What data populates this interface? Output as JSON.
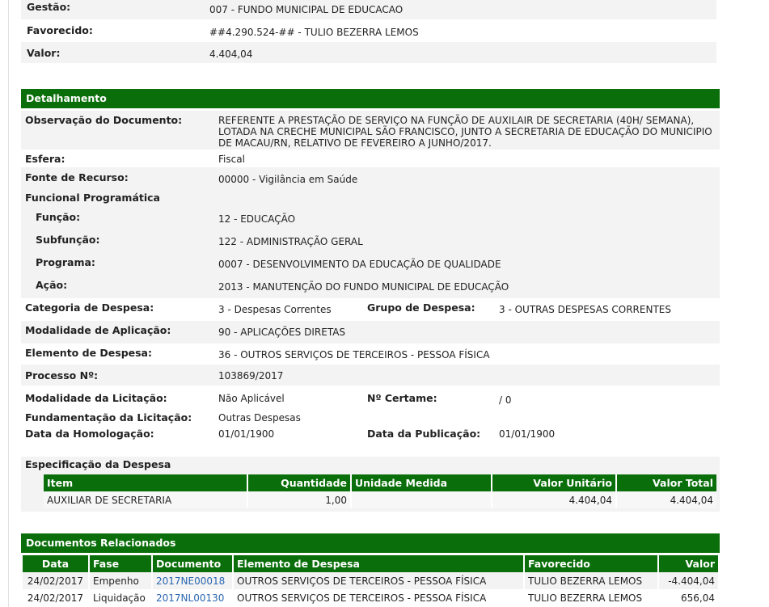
{
  "header": {
    "gestao_label": "Gestão:",
    "gestao_value": "007  -  FUNDO MUNICIPAL DE EDUCACAO",
    "favorecido_label": "Favorecido:",
    "favorecido_value": "##4.290.524-##  -  TULIO BEZERRA LEMOS",
    "valor_label": "Valor:",
    "valor_value": "4.404,04"
  },
  "detalhamento": {
    "title": "Detalhamento",
    "observacao_label": "Observação do Documento:",
    "observacao_lines": [
      "REFERENTE A PRESTAÇÃO DE SERVIÇO NA FUNÇÃO DE AUXILAIR DE SECRETARIA (40H/ SEMANA),",
      "LOTADA NA CRECHE MUNICIPAL SÃO FRANCISCO, JUNTO A SECRETARIA DE EDUCAÇÃO DO MUNICIPIO",
      "DE MACAU/RN, RELATIVO DE FEVEREIRO A JUNHO/2017."
    ],
    "esfera_label": "Esfera:",
    "esfera_value": "Fiscal",
    "fonte_label": "Fonte de Recurso:",
    "fonte_value": "00000  -  Vigilância em Saúde",
    "funcional_label": "Funcional Programática",
    "funcao_label": "Função:",
    "funcao_value": "12  -  EDUCAÇÃO",
    "subfuncao_label": "Subfunção:",
    "subfuncao_value": "122  -  ADMINISTRAÇÃO GERAL",
    "programa_label": "Programa:",
    "programa_value": "0007  -  DESENVOLVIMENTO DA EDUCAÇÃO DE QUALIDADE",
    "acao_label": "Ação:",
    "acao_value": "2013  -  MANUTENÇÃO DO FUNDO MUNICIPAL DE EDUCAÇÃO",
    "categoria_label": "Categoria de Despesa:",
    "categoria_value": "3  -  Despesas Correntes",
    "grupo_label": "Grupo de Despesa:",
    "grupo_value": "3  -  OUTRAS DESPESAS CORRENTES",
    "modalidade_aplicacao_label": "Modalidade de Aplicação:",
    "modalidade_aplicacao_value": "90  -  APLICAÇÕES DIRETAS",
    "elemento_label": "Elemento de Despesa:",
    "elemento_value": "36  -  OUTROS SERVIÇOS DE TERCEIROS - PESSOA FÍSICA",
    "processo_label": "Processo Nº:",
    "processo_value": "103869/2017",
    "modalidade_licitacao_label": "Modalidade da Licitação:",
    "modalidade_licitacao_value": "Não Aplicável",
    "certame_label": "Nº Certame:",
    "certame_value": "/  0",
    "fundamentacao_label": "Fundamentação da Licitação:",
    "fundamentacao_value": "Outras Despesas",
    "homologacao_label": "Data da Homologação:",
    "homologacao_value": "01/01/1900",
    "publicacao_label": "Data da Publicação:",
    "publicacao_value": "01/01/1900"
  },
  "especificacao": {
    "title": "Especificação da Despesa",
    "columns": [
      "Item",
      "Quantidade",
      "Unidade Medida",
      "Valor Unitário",
      "Valor Total"
    ],
    "rows": [
      [
        "AUXILIAR DE SECRETARIA",
        "1,00",
        "",
        "4.404,04",
        "4.404,04"
      ]
    ]
  },
  "documentos": {
    "title": "Documentos Relacionados",
    "columns": [
      "Data",
      "Fase",
      "Documento",
      "Elemento de Despesa",
      "Favorecido",
      "Valor"
    ],
    "rows": [
      [
        "24/02/2017",
        "Empenho",
        "2017NE00018",
        "OUTROS SERVIÇOS DE TERCEIROS - PESSOA FÍSICA",
        "TULIO BEZERRA LEMOS",
        "-4.404,04"
      ],
      [
        "24/02/2017",
        "Liquidação",
        "2017NL00130",
        "OUTROS SERVIÇOS DE TERCEIROS - PESSOA FÍSICA",
        "TULIO BEZERRA LEMOS",
        "656,04"
      ]
    ]
  },
  "colors": {
    "header_green": "#0a6e0a",
    "row_gray": "#f3f3f3",
    "link_blue": "#2a66b0"
  }
}
